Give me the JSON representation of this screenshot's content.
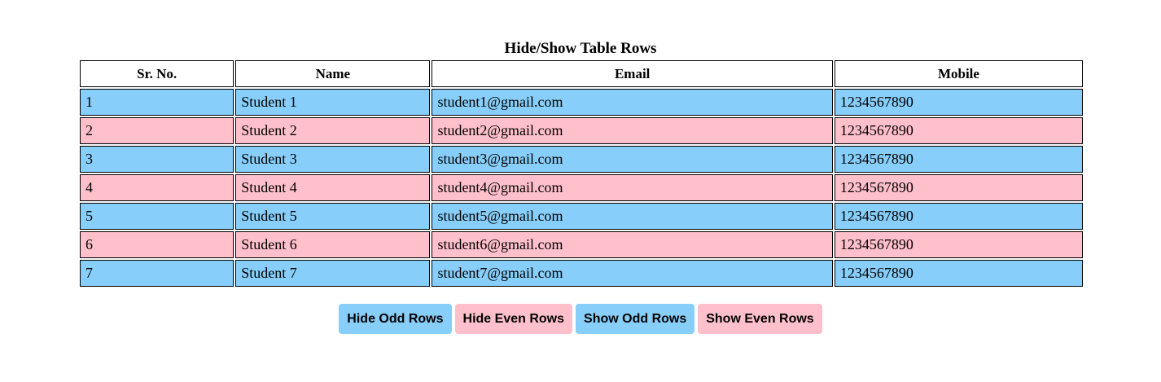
{
  "table": {
    "caption": "Hide/Show Table Rows",
    "headers": [
      "Sr. No.",
      "Name",
      "Email",
      "Mobile"
    ],
    "rows": [
      {
        "sr": "1",
        "name": "Student 1",
        "email": "student1@gmail.com",
        "mobile": "1234567890"
      },
      {
        "sr": "2",
        "name": "Student 2",
        "email": "student2@gmail.com",
        "mobile": "1234567890"
      },
      {
        "sr": "3",
        "name": "Student 3",
        "email": "student3@gmail.com",
        "mobile": "1234567890"
      },
      {
        "sr": "4",
        "name": "Student 4",
        "email": "student4@gmail.com",
        "mobile": "1234567890"
      },
      {
        "sr": "5",
        "name": "Student 5",
        "email": "student5@gmail.com",
        "mobile": "1234567890"
      },
      {
        "sr": "6",
        "name": "Student 6",
        "email": "student6@gmail.com",
        "mobile": "1234567890"
      },
      {
        "sr": "7",
        "name": "Student 7",
        "email": "student7@gmail.com",
        "mobile": "1234567890"
      }
    ]
  },
  "buttons": {
    "hide_odd": "Hide Odd Rows",
    "hide_even": "Hide Even Rows",
    "show_odd": "Show Odd Rows",
    "show_even": "Show Even Rows"
  },
  "colors": {
    "odd_row": "#87cefa",
    "even_row": "#ffc0cb"
  }
}
